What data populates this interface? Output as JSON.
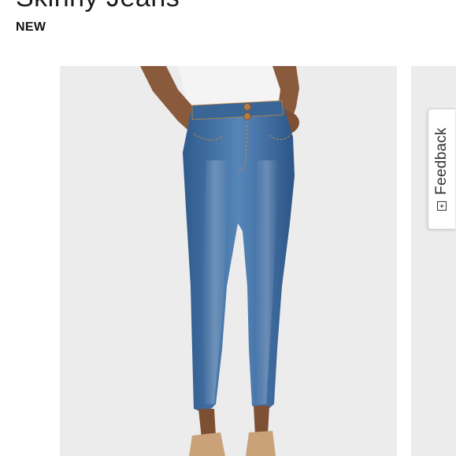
{
  "product": {
    "title": "Skinny Jeans",
    "badge": "NEW"
  },
  "feedback_tab": {
    "label": "Feedback",
    "icon": "feedback-plus-icon",
    "icon_glyph": "+"
  },
  "gallery": {
    "main_image_alt": "high waisted skinny jeans",
    "next_image_alt": "next product image"
  },
  "colors": {
    "denim": "#3f6b9f",
    "image_bg": "#ececec",
    "text": "#1a1a1a"
  }
}
